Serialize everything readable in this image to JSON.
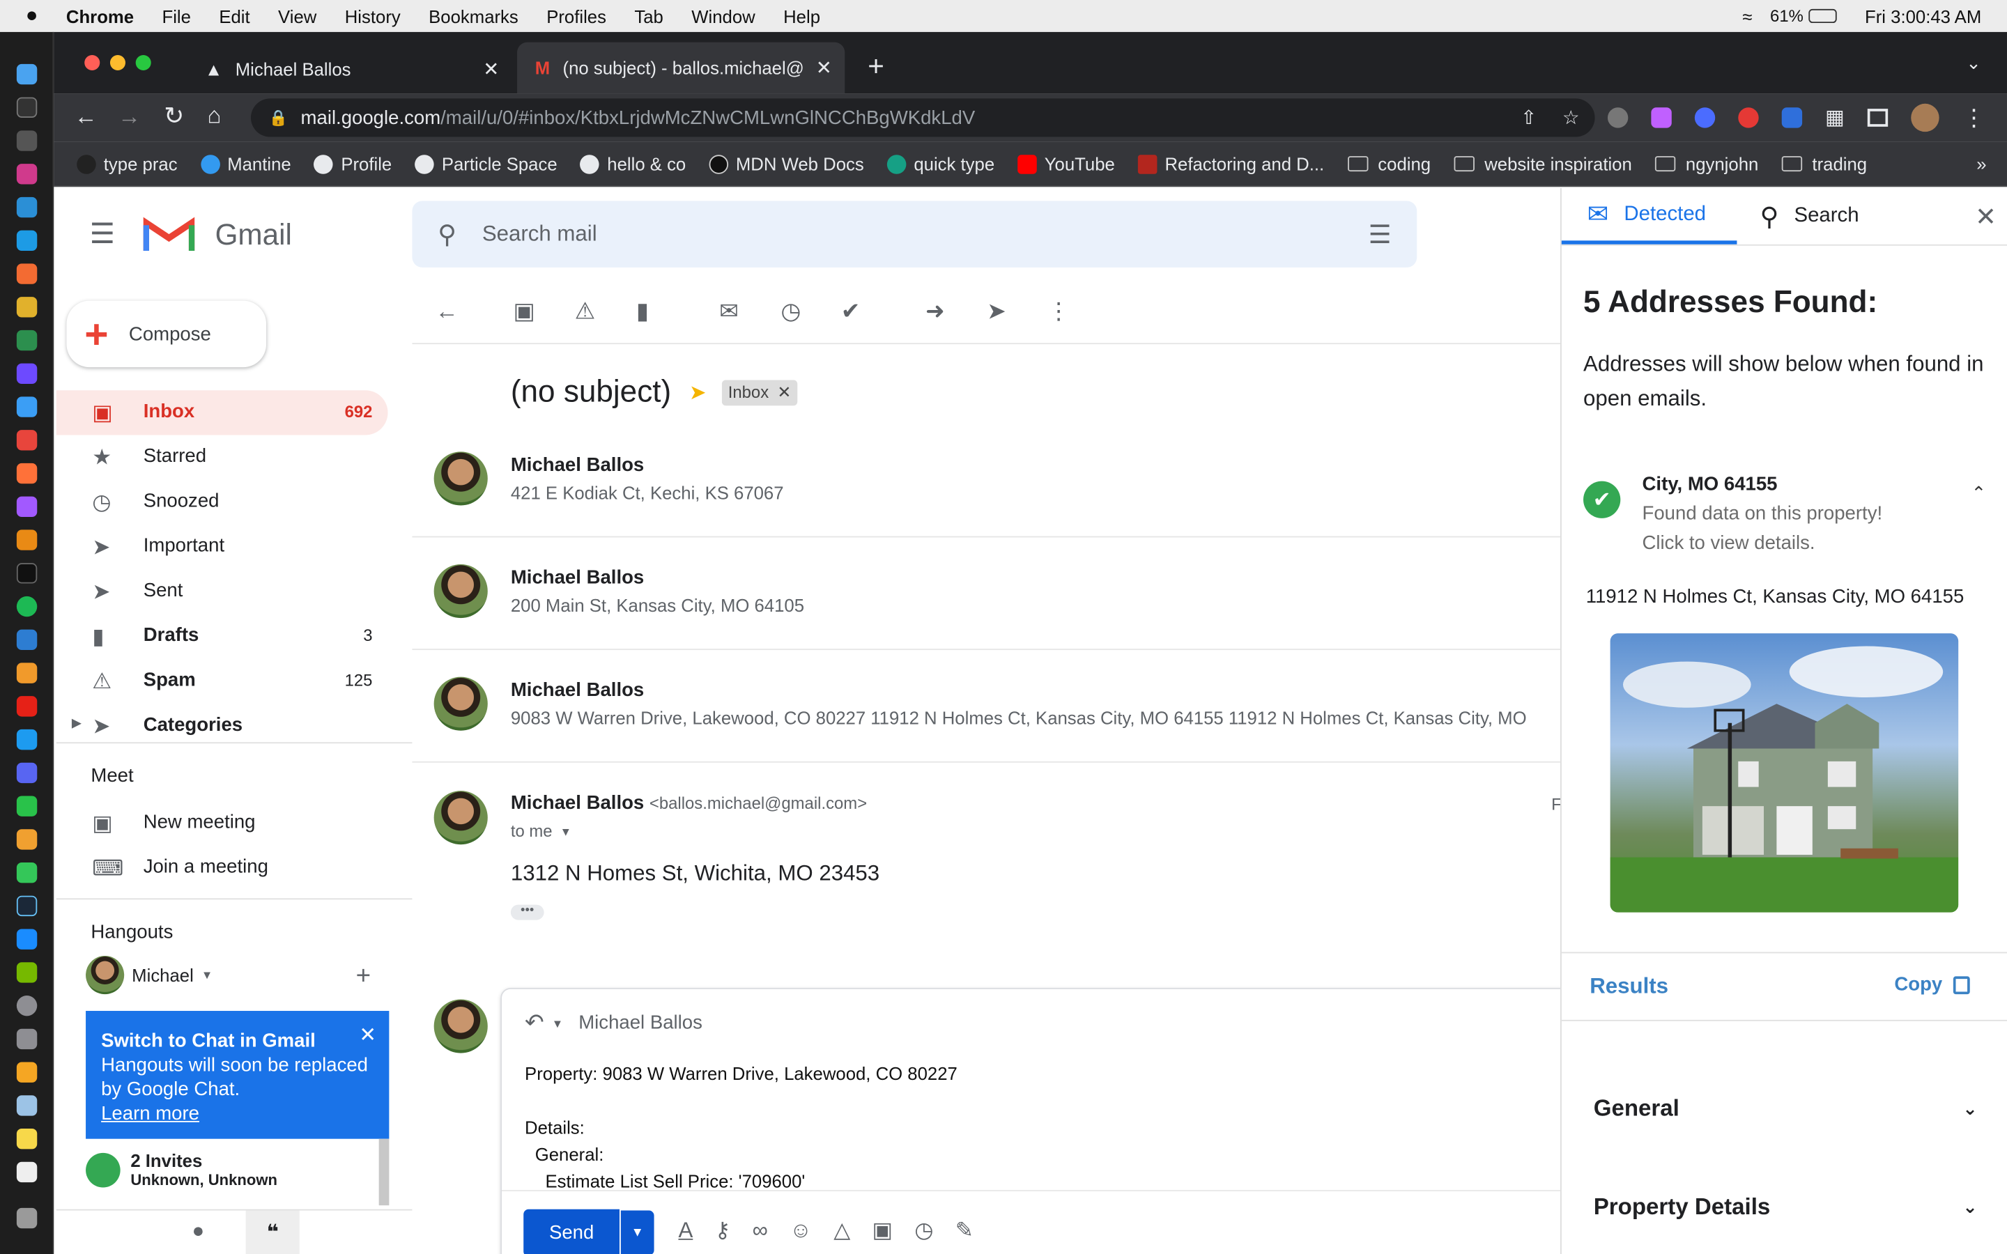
{
  "menubar": {
    "app": "Chrome",
    "items": [
      "File",
      "Edit",
      "View",
      "History",
      "Bookmarks",
      "Profiles",
      "Tab",
      "Window",
      "Help"
    ],
    "battery": "61%",
    "clock": "Fri  3:00:43 AM"
  },
  "tabs": [
    {
      "title": "Michael Ballos"
    },
    {
      "title": "(no subject) - ballos.michael@"
    }
  ],
  "url": {
    "host": "mail.google.com",
    "path": "/mail/u/0/#inbox/KtbxLrjdwMcZNwCMLwnGlNCChBgWKdkLdV"
  },
  "bookmarks": [
    "type prac",
    "Mantine",
    "Profile",
    "Particle Space",
    "hello & co",
    "MDN Web Docs",
    "quick type",
    "YouTube",
    "Refactoring and D...",
    "coding",
    "website inspiration",
    "ngynjohn",
    "trading"
  ],
  "gmail": {
    "logo": "Gmail",
    "search_placeholder": "Search mail",
    "compose": "Compose",
    "nav": [
      {
        "label": "Inbox",
        "count": "692"
      },
      {
        "label": "Starred",
        "count": ""
      },
      {
        "label": "Snoozed",
        "count": ""
      },
      {
        "label": "Important",
        "count": ""
      },
      {
        "label": "Sent",
        "count": ""
      },
      {
        "label": "Drafts",
        "count": "3"
      },
      {
        "label": "Spam",
        "count": "125"
      },
      {
        "label": "Categories",
        "count": ""
      }
    ],
    "meet": {
      "title": "Meet",
      "new": "New meeting",
      "join": "Join a meeting"
    },
    "hangouts": {
      "title": "Hangouts",
      "user": "Michael",
      "banner_title": "Switch to Chat in Gmail",
      "banner_body": "Hangouts will soon be replaced by Google Chat.",
      "banner_link": "Learn more",
      "invites": "2 Invites",
      "invites_sub": "Unknown, Unknown"
    },
    "subject": "(no subject)",
    "label": "Inbox",
    "messages": [
      {
        "sender": "Michael Ballos",
        "snippet": "421 E Kodiak Ct, Kechi, KS 67067"
      },
      {
        "sender": "Michael Ballos",
        "snippet": "200 Main St, Kansas City, MO 64105"
      },
      {
        "sender": "Michael Ballos",
        "snippet": "9083 W Warren Drive, Lakewood, CO 80227 11912 N Holmes Ct, Kansas City, MO 64155 11912 N Holmes Ct, Kansas City, MO"
      }
    ],
    "open": {
      "sender": "Michael Ballos",
      "email": "<ballos.michael@gmail.com>",
      "to": "to me",
      "body": "1312 N Homes St, Wichita, MO 23453",
      "date_initial": "F"
    },
    "reply": {
      "to": "Michael Ballos",
      "lines": [
        "Property: 9083 W Warren Drive, Lakewood, CO 80227",
        "Details:",
        "General:",
        "Estimate List Sell Price: '709600'"
      ],
      "send": "Send"
    }
  },
  "panel": {
    "tab_detected": "Detected",
    "tab_search": "Search",
    "heading": "5 Addresses Found:",
    "desc": "Addresses will show below when found in open emails.",
    "card": {
      "title": "City, MO 64155",
      "sub1": "Found data on this property!",
      "sub2": "Click to view details."
    },
    "address": "11912 N Holmes Ct, Kansas City, MO 64155",
    "results": "Results",
    "copy": "Copy",
    "sections": [
      "General",
      "Property Details"
    ]
  },
  "colors": {
    "gmail_red": "#d93025",
    "blue": "#1a73e8",
    "success": "#34a853"
  }
}
